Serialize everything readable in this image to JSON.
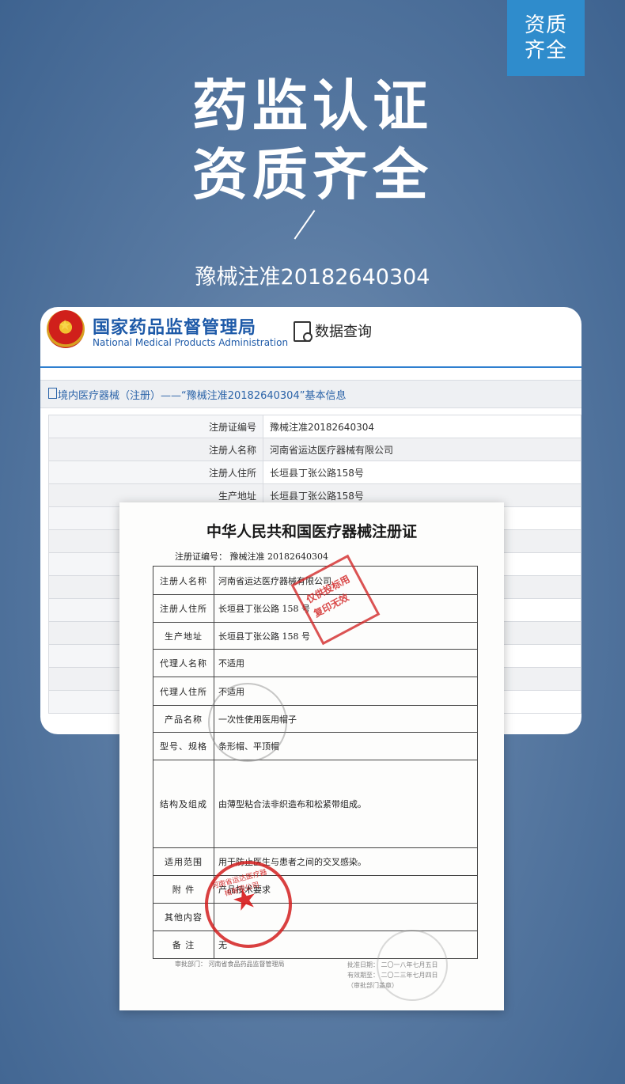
{
  "corner_tag": [
    "资质",
    "齐全"
  ],
  "hero": {
    "line1": "药监认证",
    "line2": "资质齐全",
    "registration": "豫械注准20182640304"
  },
  "nmpa": {
    "name_cn": "国家药品监督管理局",
    "name_en": "National Medical Products Administration",
    "query_label": "数据查询",
    "breadcrumb": "境内医疗器械（注册）——“豫械注准20182640304”基本信息",
    "rows": [
      {
        "key": "注册证编号",
        "value": "豫械注准20182640304"
      },
      {
        "key": "注册人名称",
        "value": "河南省运达医疗器械有限公司"
      },
      {
        "key": "注册人住所",
        "value": "长垣县丁张公路158号"
      },
      {
        "key": "生产地址",
        "value": "长垣县丁张公路158号"
      }
    ]
  },
  "certificate": {
    "title": "中华人民共和国医疗器械注册证",
    "number": "注册证编号： 豫械注准 20182640304",
    "rows": [
      {
        "key": "注册人名称",
        "value": "河南省运达医疗器械有限公司",
        "h": 36
      },
      {
        "key": "注册人住所",
        "value": "长垣县丁张公路 158 号",
        "h": 35
      },
      {
        "key": "生产地址",
        "value": "长垣县丁张公路 158 号",
        "h": 34
      },
      {
        "key": "代理人名称",
        "value": "不适用",
        "h": 35
      },
      {
        "key": "代理人住所",
        "value": "不适用",
        "h": 36
      },
      {
        "key": "产品名称",
        "value": "一次性使用医用帽子",
        "h": 34
      },
      {
        "key": "型号、规格",
        "value": "条形帽、平顶帽",
        "h": 35
      },
      {
        "key": "结构及组成",
        "value": "由薄型粘合法非织造布和松紧带组成。",
        "h": 111
      },
      {
        "key": "适用范围",
        "value": "用于防止医生与患者之间的交叉感染。",
        "h": 35
      },
      {
        "key": "附 件",
        "value": "产品技术要求",
        "h": 35
      },
      {
        "key": "其他内容",
        "value": "",
        "h": 35
      },
      {
        "key": "备 注",
        "value": "无",
        "h": 35
      }
    ],
    "footer_left": "审批部门： 河南省食品药品监督管理局",
    "footer_right_1": "批准日期： 二〇一八年七月五日",
    "footer_right_2": "有效期至： 二〇二三年七月四日",
    "footer_right_3": "（审批部门盖章）",
    "seal_company": "河南省运达医疗器械有限公司",
    "seal_copy": "仅供投标用 复印无效"
  }
}
